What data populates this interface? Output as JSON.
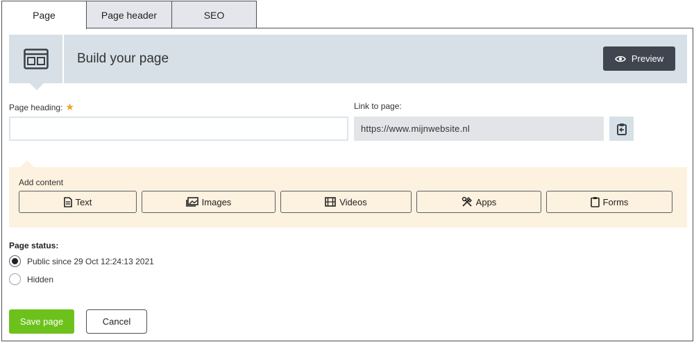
{
  "tabs": [
    {
      "label": "Page",
      "active": true
    },
    {
      "label": "Page header",
      "active": false
    },
    {
      "label": "SEO",
      "active": false
    }
  ],
  "build": {
    "title": "Build your page",
    "preview_label": "Preview",
    "icon": "layout-icon"
  },
  "fields": {
    "heading_label": "Page heading:",
    "heading_required_icon": "star-icon",
    "heading_value": "",
    "link_label": "Link to page:",
    "link_value": "https://www.mijnwebsite.nl",
    "copy_icon": "clipboard-icon"
  },
  "add_content": {
    "title": "Add content",
    "buttons": [
      {
        "label": "Text",
        "icon": "document-icon"
      },
      {
        "label": "Images",
        "icon": "images-icon"
      },
      {
        "label": "Videos",
        "icon": "film-icon"
      },
      {
        "label": "Apps",
        "icon": "tools-icon"
      },
      {
        "label": "Forms",
        "icon": "clipboard-icon"
      }
    ]
  },
  "status": {
    "title": "Page status:",
    "options": [
      {
        "label": "Public since 29 Oct 12:24:13 2021",
        "selected": true
      },
      {
        "label": "Hidden",
        "selected": false
      }
    ]
  },
  "actions": {
    "save_label": "Save page",
    "cancel_label": "Cancel"
  },
  "colors": {
    "accent_green": "#6cc21b",
    "header_band": "#d6e0e6",
    "content_band": "#fdf1df",
    "preview_button": "#3f4650",
    "required_star": "#f0a01e"
  }
}
